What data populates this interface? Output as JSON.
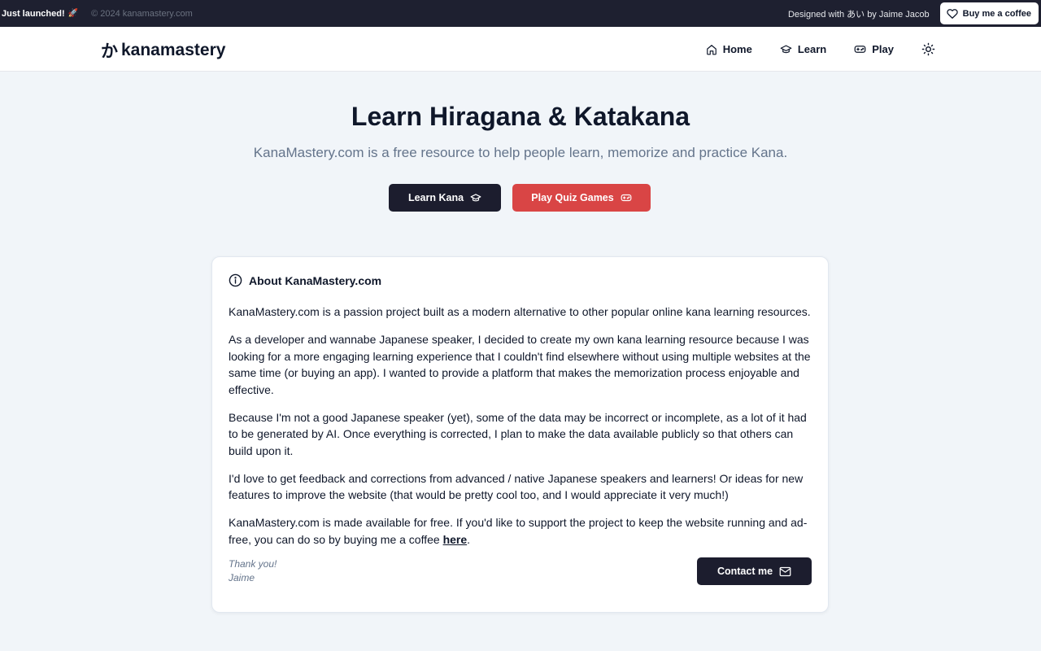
{
  "topbar": {
    "launched_label": "Just launched!",
    "launched_emoji": "🚀",
    "copyright": "© 2024 kanamastery.com",
    "designed_by": "Designed with あい by Jaime Jacob",
    "coffee_button": "Buy me a coffee",
    "background_color": "#1e2030"
  },
  "header": {
    "logo_kana": "か",
    "logo_text": "kanamastery",
    "nav": [
      {
        "label": "Home",
        "icon": "home-icon"
      },
      {
        "label": "Learn",
        "icon": "graduation-cap-icon"
      },
      {
        "label": "Play",
        "icon": "gamepad-icon"
      }
    ],
    "theme_icon": "sun-icon"
  },
  "hero": {
    "title": "Learn Hiragana & Katakana",
    "subtitle": "KanaMastery.com is a free resource to help people learn, memorize and practice Kana.",
    "learn_button": "Learn Kana",
    "play_button": "Play Quiz Games",
    "dark_button_color": "#1c1d2e",
    "red_button_color": "#d94545"
  },
  "about": {
    "title": "About KanaMastery.com",
    "paragraphs": [
      "KanaMastery.com is a passion project built as a modern alternative to other popular online kana learning resources.",
      "As a developer and wannabe Japanese speaker, I decided to create my own kana learning resource because I was looking for a more engaging learning experience that I couldn't find elsewhere without using multiple websites at the same time (or buying an app). I wanted to provide a platform that makes the memorization process enjoyable and effective.",
      "Because I'm not a good Japanese speaker (yet), some of the data may be incorrect or incomplete, as a lot of it had to be generated by AI. Once everything is corrected, I plan to make the data available publicly so that others can build upon it.",
      "I'd love to get feedback and corrections from advanced / native Japanese speakers and learners! Or ideas for new features to improve the website (that would be pretty cool too, and I would appreciate it very much!)"
    ],
    "support_text": "KanaMastery.com is made available for free. If you'd like to support the project to keep the website running and ad-free, you can do so by buying me a coffee ",
    "support_link": "here",
    "support_end": ".",
    "signoff_line1": "Thank you!",
    "signoff_line2": "Jaime",
    "contact_button": "Contact me"
  }
}
